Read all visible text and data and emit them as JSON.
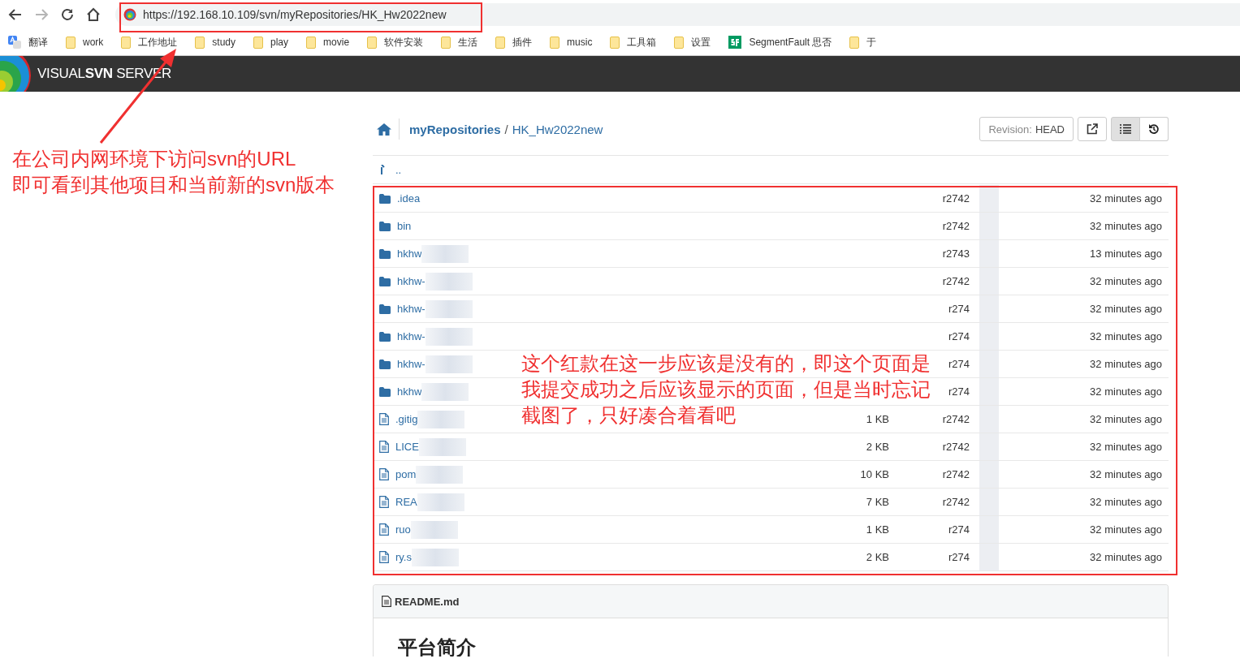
{
  "browser": {
    "nav": [
      {
        "kind": "back",
        "disabled": false
      },
      {
        "kind": "forward",
        "disabled": true
      },
      {
        "kind": "reload",
        "disabled": false
      },
      {
        "kind": "home",
        "disabled": false
      }
    ],
    "url": "https://192.168.10.109/svn/myRepositories/HK_Hw2022new",
    "bookmarks": [
      {
        "kind": "translate",
        "label": "翻译"
      },
      {
        "kind": "folder",
        "label": "work"
      },
      {
        "kind": "folder",
        "label": "工作地址"
      },
      {
        "kind": "folder",
        "label": "study"
      },
      {
        "kind": "folder",
        "label": "play"
      },
      {
        "kind": "folder",
        "label": "movie"
      },
      {
        "kind": "folder",
        "label": "软件安装"
      },
      {
        "kind": "folder",
        "label": "生活"
      },
      {
        "kind": "folder",
        "label": "插件"
      },
      {
        "kind": "folder",
        "label": "music"
      },
      {
        "kind": "folder",
        "label": "工具箱"
      },
      {
        "kind": "folder",
        "label": "设置"
      },
      {
        "kind": "sf",
        "label": "SegmentFault 思否"
      },
      {
        "kind": "folder",
        "label": "于"
      }
    ]
  },
  "header": {
    "product": "VISUAL**SVN** SERVER"
  },
  "breadcrumb": {
    "items": [
      "myRepositories",
      "HK_Hw2022new"
    ],
    "separator": "/"
  },
  "toolbar": {
    "revision_label": "Revision:",
    "revision_value": "HEAD",
    "view_list_selected": true
  },
  "parent_link": "..",
  "table": {
    "rows": [
      {
        "kind": "folder",
        "name": ".idea",
        "size": "",
        "revision": "r2742",
        "time": "32 minutes ago",
        "redacted": false
      },
      {
        "kind": "folder",
        "name": "bin",
        "size": "",
        "revision": "r2742",
        "time": "32 minutes ago",
        "redacted": false
      },
      {
        "kind": "folder",
        "name": "hkhw",
        "size": "",
        "revision": "r2743",
        "time": "13 minutes ago",
        "redacted": true
      },
      {
        "kind": "folder",
        "name": "hkhw-",
        "size": "",
        "revision": "r2742",
        "time": "32 minutes ago",
        "redacted": true
      },
      {
        "kind": "folder",
        "name": "hkhw-",
        "size": "",
        "revision": "r274",
        "time": "32 minutes ago",
        "redacted": true
      },
      {
        "kind": "folder",
        "name": "hkhw-",
        "size": "",
        "revision": "r274",
        "time": "32 minutes ago",
        "redacted": true
      },
      {
        "kind": "folder",
        "name": "hkhw-",
        "size": "",
        "revision": "r274",
        "time": "32 minutes ago",
        "redacted": true
      },
      {
        "kind": "folder",
        "name": "hkhw",
        "size": "",
        "revision": "r274",
        "time": "32 minutes ago",
        "redacted": true
      },
      {
        "kind": "file",
        "name": ".gitig",
        "size": "1 KB",
        "revision": "r2742",
        "time": "32 minutes ago",
        "redacted": true
      },
      {
        "kind": "file",
        "name": "LICE",
        "size": "2 KB",
        "revision": "r2742",
        "time": "32 minutes ago",
        "redacted": true
      },
      {
        "kind": "file",
        "name": "pom",
        "size": "10 KB",
        "revision": "r2742",
        "time": "32 minutes ago",
        "redacted": true
      },
      {
        "kind": "file",
        "name": "REA",
        "size": "7 KB",
        "revision": "r2742",
        "time": "32 minutes ago",
        "redacted": true
      },
      {
        "kind": "file",
        "name": "ruo",
        "size": "1 KB",
        "revision": "r274",
        "time": "32 minutes ago",
        "redacted": true
      },
      {
        "kind": "file",
        "name": "ry.s",
        "size": "2 KB",
        "revision": "r274",
        "time": "32 minutes ago",
        "redacted": true
      }
    ]
  },
  "readme": {
    "filename": "README.md",
    "heading": "平台简介"
  },
  "annotations": [
    {
      "kind": "note",
      "lines": [
        "在公司内网环境下访问svn的URL",
        "即可看到其他项目和当前新的svn版本"
      ]
    },
    {
      "kind": "note",
      "lines": [
        "这个红款在这一步应该是没有的，即这个页面是",
        "我提交成功之后应该显示的页面，但是当时忘记",
        "截图了，只好凑合着看吧"
      ]
    }
  ]
}
